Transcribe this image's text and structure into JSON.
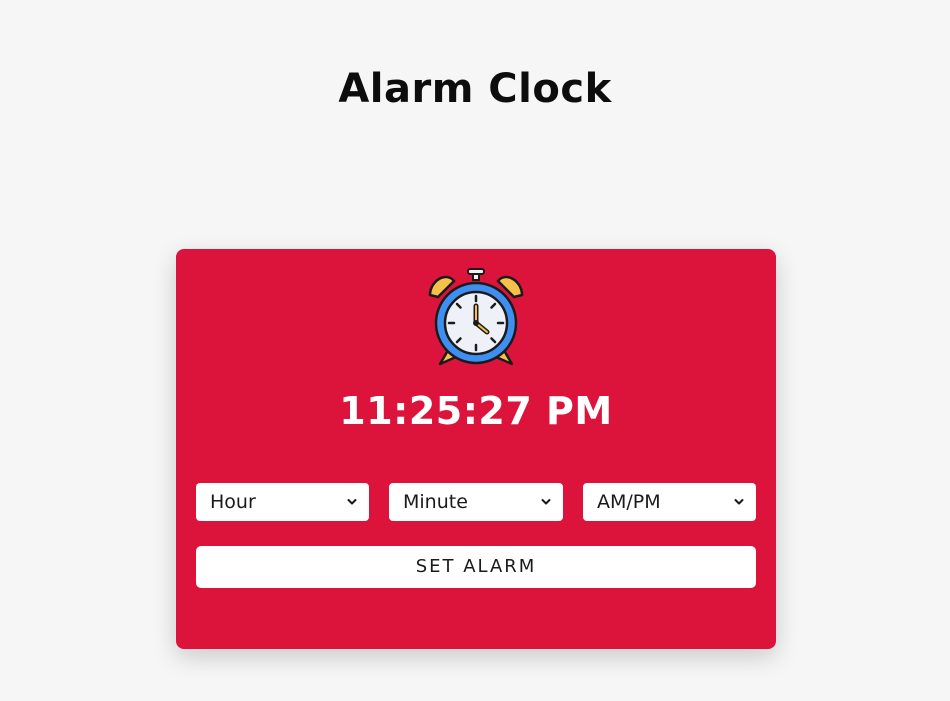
{
  "page": {
    "title": "Alarm Clock"
  },
  "clock": {
    "icon": "alarm-clock-icon",
    "current_time": "11:25:27 PM"
  },
  "controls": {
    "hour_select": {
      "selected": "Hour"
    },
    "minute_select": {
      "selected": "Minute"
    },
    "ampm_select": {
      "selected": "AM/PM"
    },
    "set_alarm_label": "SET ALARM"
  },
  "colors": {
    "background": "#f6f6f6",
    "card": "#dc143c",
    "text_light": "#ffffff",
    "text_dark": "#0d0d0d"
  }
}
